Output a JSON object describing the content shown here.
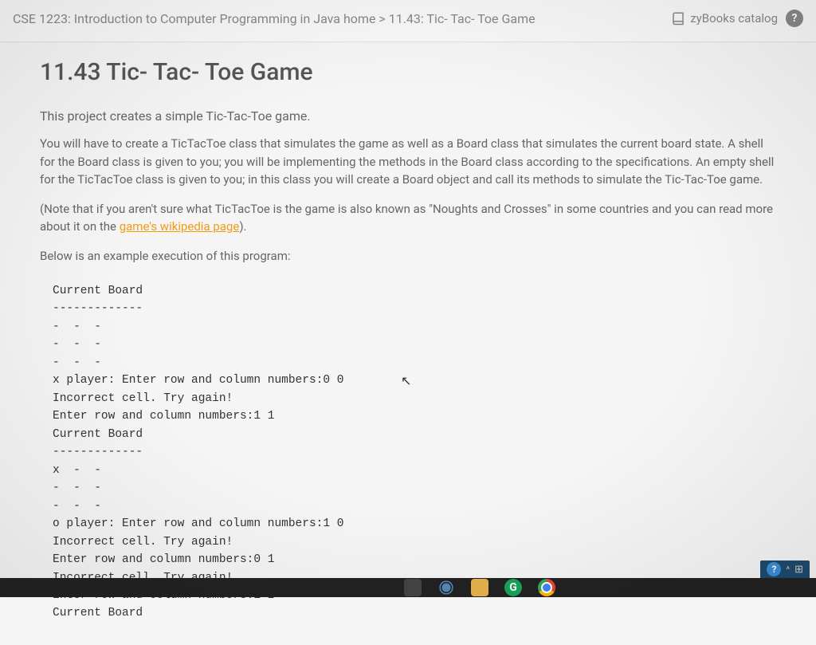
{
  "header": {
    "breadcrumb": "CSE 1223: Introduction to Computer Programming in Java home > 11.43: Tic- Tac- Toe Game",
    "catalog_label": "zyBooks catalog"
  },
  "page": {
    "title": "11.43 Tic- Tac- Toe Game",
    "intro": "This project creates a simple Tic-Tac-Toe game.",
    "para1": "You will have to create a TicTacToe class that simulates the game as well as a Board class that simulates the current board state. A shell for the Board class is given to you; you will be implementing the methods in the Board class according to the specifications. An empty shell for the TicTacToe class is given to you; in this class you will create a Board object and call its methods to simulate the Tic-Tac-Toe game.",
    "para2_pre": "(Note that if you aren't sure what TicTacToe is the game is also known as \"Noughts and Crosses\" in some countries and you can read more about it on the ",
    "wiki_link": "game's wikipedia page",
    "para2_post": ").",
    "para3": "Below is an example execution of this program:",
    "code": "Current Board\n-------------\n-  -  -\n-  -  -\n-  -  -\nx player: Enter row and column numbers:0 0\nIncorrect cell. Try again!\nEnter row and column numbers:1 1\nCurrent Board\n-------------\nx  -  -\n-  -  -\n-  -  -\no player: Enter row and column numbers:1 0\nIncorrect cell. Try again!\nEnter row and column numbers:0 1\nIncorrect cell. Try again!\nEnter row and column numbers:1 2\nCurrent Board"
  },
  "tray": {
    "help": "?",
    "caret": "^"
  }
}
